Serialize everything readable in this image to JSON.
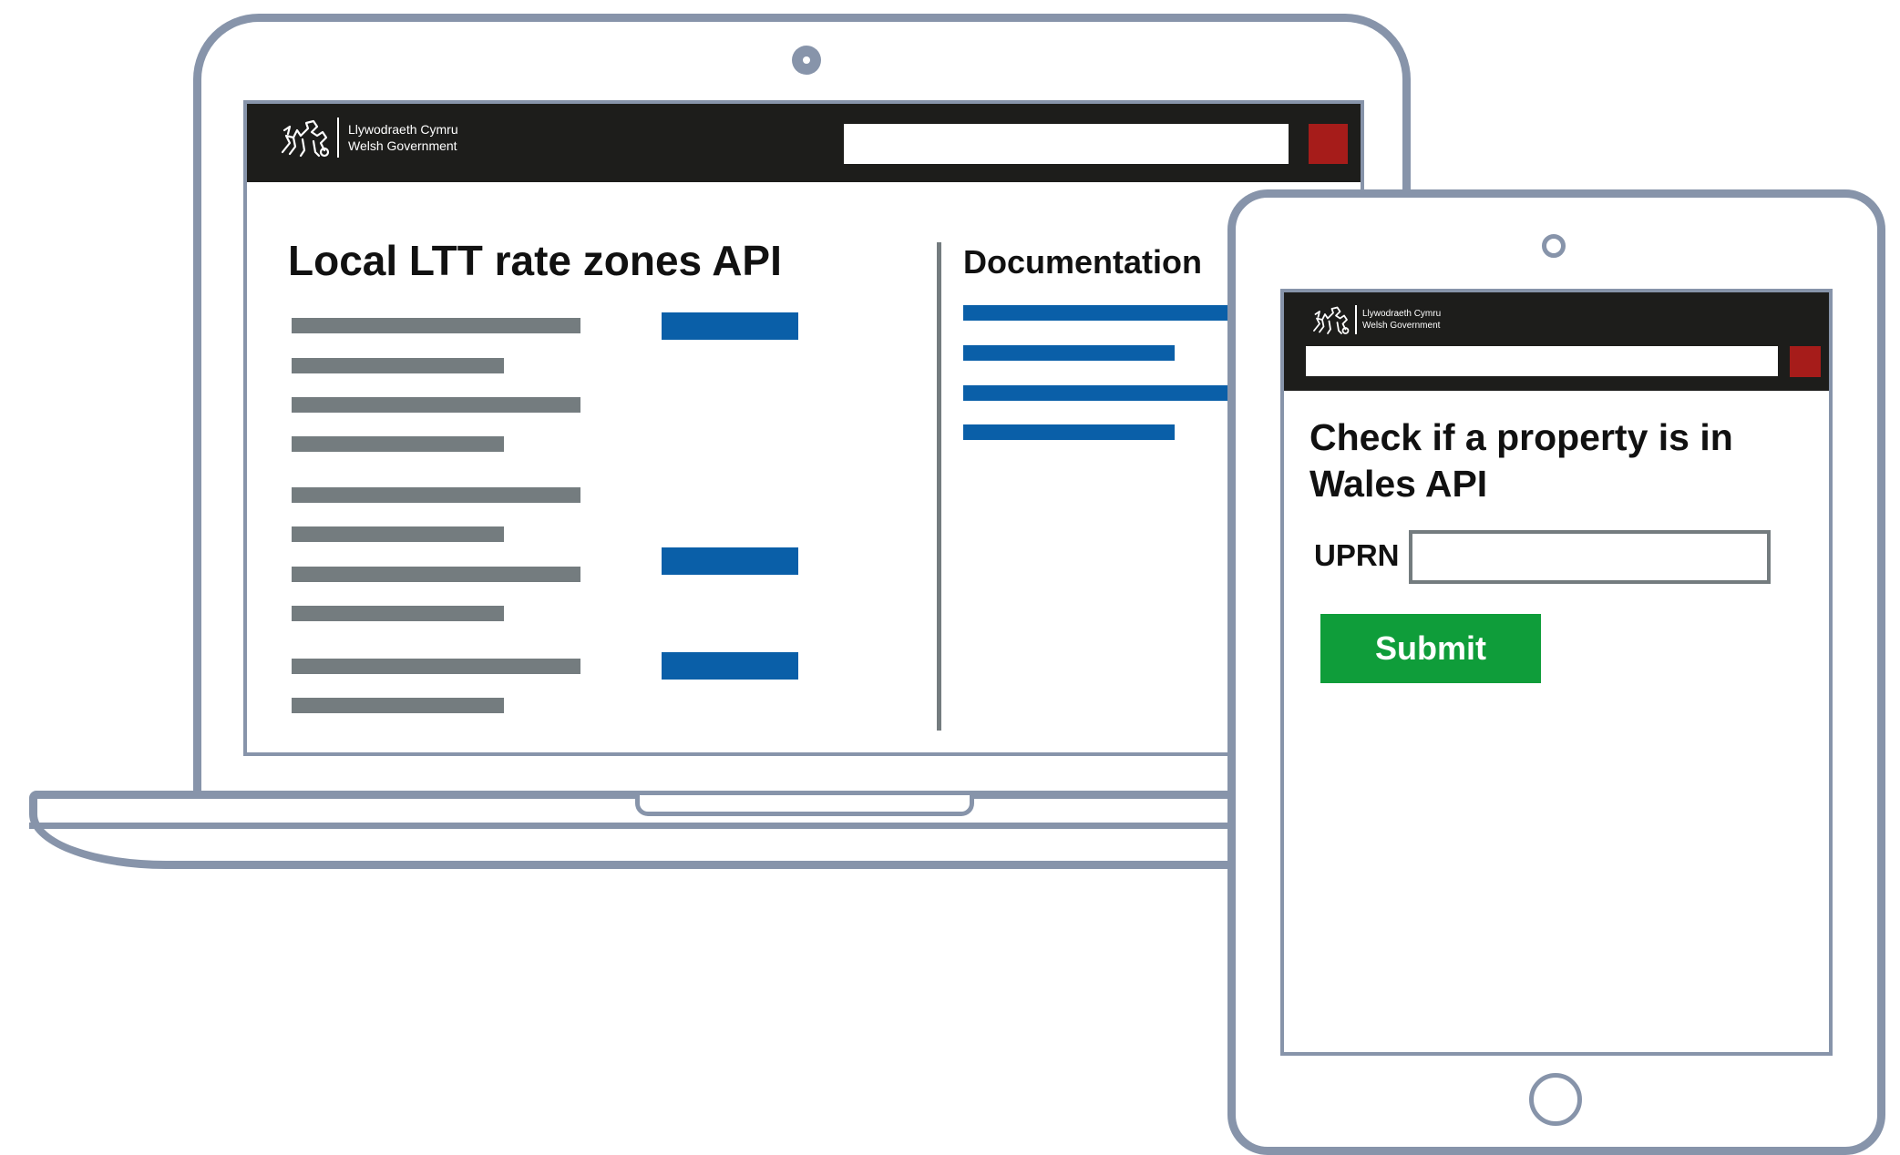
{
  "brand": {
    "name_cy": "Llywodraeth Cymru",
    "name_en": "Welsh Government"
  },
  "laptop": {
    "page_title": "Local LTT rate zones API",
    "sidebar_title": "Documentation"
  },
  "tablet": {
    "page_title": "Check if a property is in Wales API",
    "uprn_label": "UPRN",
    "uprn_value": "",
    "submit_label": "Submit"
  },
  "icons": {
    "logo": "dragon-logo-icon"
  },
  "colors": {
    "device_frame": "#8794aa",
    "header_bg": "#1d1d1b",
    "search_button": "#a61c1a",
    "link_blue": "#0a5fa8",
    "text_placeholder_grey": "#747c7f",
    "submit_green": "#0f9d3a"
  }
}
